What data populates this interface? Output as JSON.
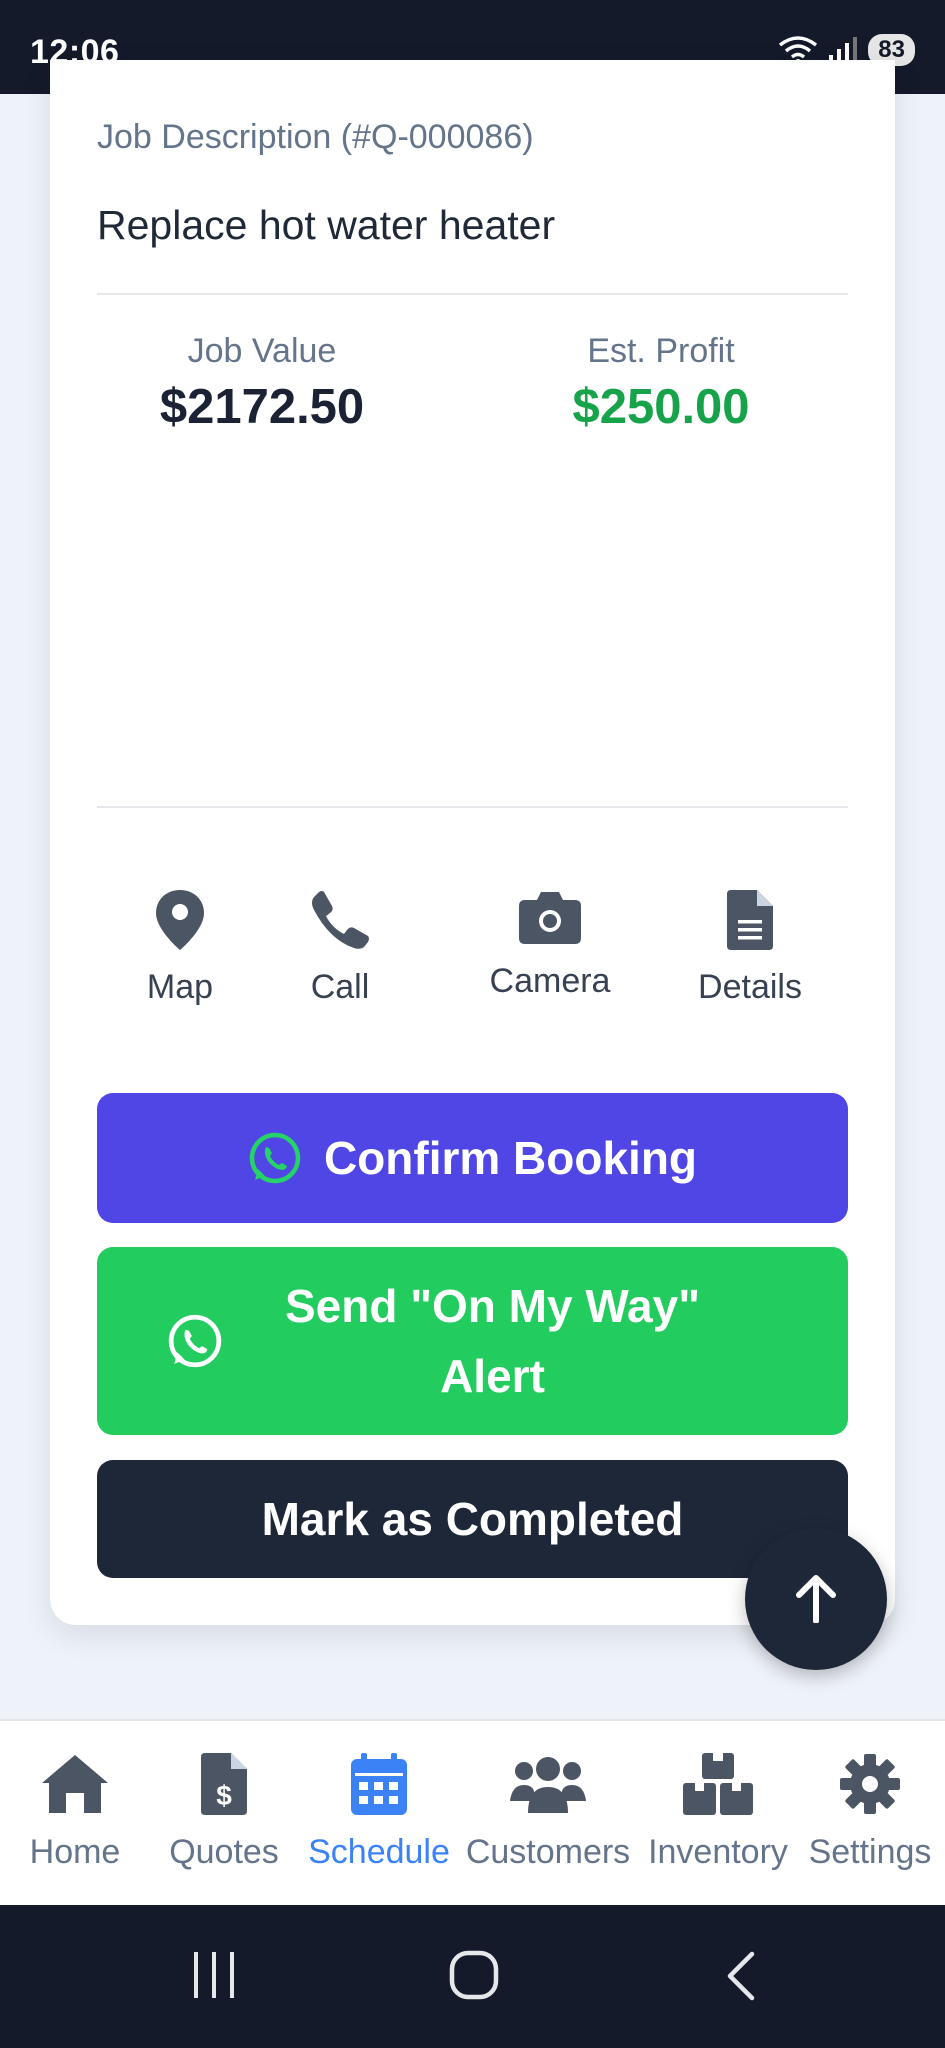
{
  "status_bar": {
    "time": "12:06",
    "battery": "83"
  },
  "job": {
    "description_label": "Job Description (#Q-000086)",
    "description": "Replace hot water heater",
    "value_label": "Job Value",
    "value": "$2172.50",
    "profit_label": "Est. Profit",
    "profit": "$250.00"
  },
  "actions": [
    {
      "label": "Map",
      "icon": "map-pin-icon"
    },
    {
      "label": "Call",
      "icon": "phone-icon"
    },
    {
      "label": "Camera",
      "icon": "camera-icon"
    },
    {
      "label": "Details",
      "icon": "document-icon"
    }
  ],
  "buttons": {
    "confirm": "Confirm Booking",
    "on_my_way_line1": "Send \"On My Way\"",
    "on_my_way_line2": "Alert",
    "complete": "Mark as Completed"
  },
  "nav": [
    {
      "label": "Home",
      "icon": "home-icon"
    },
    {
      "label": "Quotes",
      "icon": "invoice-icon"
    },
    {
      "label": "Schedule",
      "icon": "calendar-icon",
      "active": true
    },
    {
      "label": "Customers",
      "icon": "users-icon"
    },
    {
      "label": "Inventory",
      "icon": "boxes-icon"
    },
    {
      "label": "Settings",
      "icon": "gear-icon"
    }
  ],
  "colors": {
    "confirm_button": "#4f46e5",
    "whatsapp_button": "#22cc5e",
    "dark_button": "#1e2738",
    "profit": "#16a34a",
    "active_nav": "#3b82f6"
  }
}
